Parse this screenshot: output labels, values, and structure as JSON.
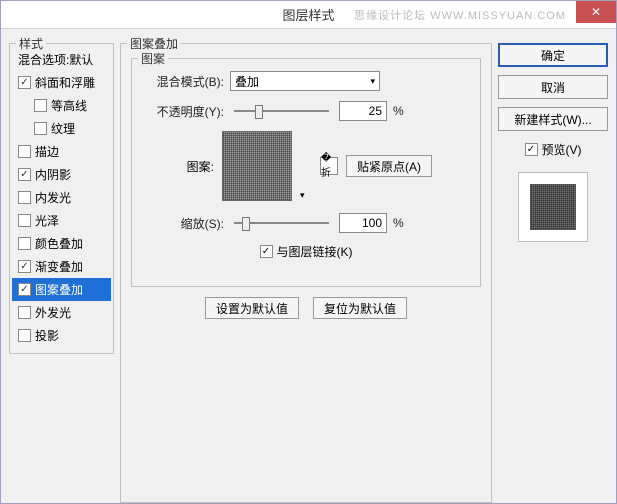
{
  "window": {
    "title": "图层样式",
    "watermark": "思缘设计论坛  WWW.MISSYUAN.COM"
  },
  "styles_panel": {
    "legend": "样式",
    "header": "混合选项:默认",
    "items": [
      {
        "label": "斜面和浮雕",
        "checked": true,
        "indent": false
      },
      {
        "label": "等高线",
        "checked": false,
        "indent": true
      },
      {
        "label": "纹理",
        "checked": false,
        "indent": true
      },
      {
        "label": "描边",
        "checked": false,
        "indent": false
      },
      {
        "label": "内阴影",
        "checked": true,
        "indent": false
      },
      {
        "label": "内发光",
        "checked": false,
        "indent": false
      },
      {
        "label": "光泽",
        "checked": false,
        "indent": false
      },
      {
        "label": "颜色叠加",
        "checked": false,
        "indent": false
      },
      {
        "label": "渐变叠加",
        "checked": true,
        "indent": false
      },
      {
        "label": "图案叠加",
        "checked": true,
        "indent": false,
        "selected": true
      },
      {
        "label": "外发光",
        "checked": false,
        "indent": false
      },
      {
        "label": "投影",
        "checked": false,
        "indent": false
      }
    ]
  },
  "main": {
    "legend": "图案叠加",
    "inner_legend": "图案",
    "blend_mode_label": "混合模式(B):",
    "blend_mode_value": "叠加",
    "opacity_label": "不透明度(Y):",
    "opacity_value": "25",
    "opacity_unit": "%",
    "pattern_label": "图案:",
    "snap_origin_btn": "贴紧原点(A)",
    "scale_label": "缩放(S):",
    "scale_value": "100",
    "scale_unit": "%",
    "link_layer_label": "与图层链接(K)",
    "set_default_btn": "设置为默认值",
    "reset_default_btn": "复位为默认值"
  },
  "right": {
    "ok": "确定",
    "cancel": "取消",
    "new_style": "新建样式(W)...",
    "preview_label": "预览(V)"
  }
}
